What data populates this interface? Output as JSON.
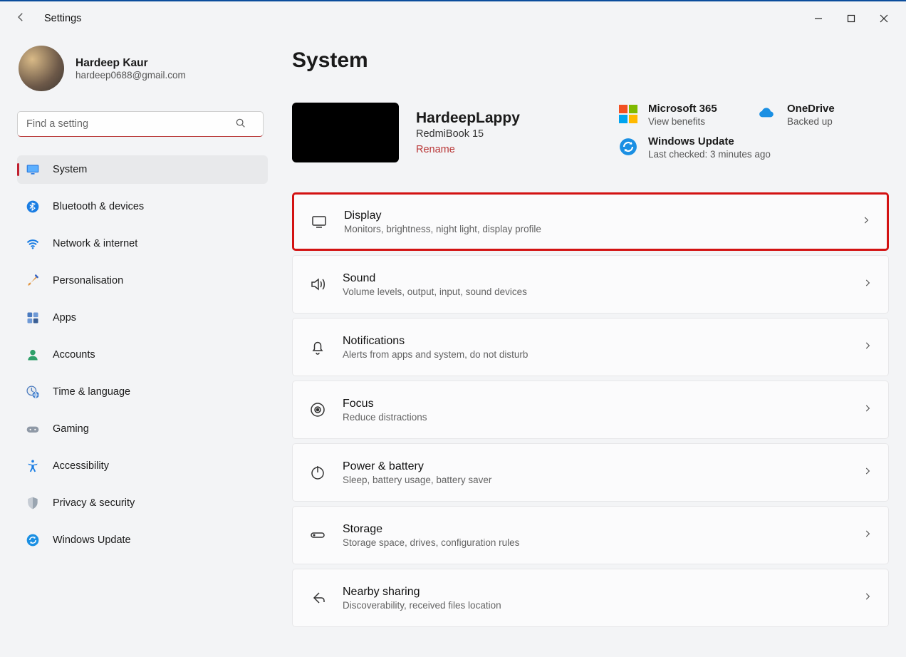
{
  "window": {
    "title": "Settings"
  },
  "profile": {
    "name": "Hardeep Kaur",
    "email": "hardeep0688@gmail.com"
  },
  "search": {
    "placeholder": "Find a setting"
  },
  "sidebar": {
    "items": [
      {
        "label": "System"
      },
      {
        "label": "Bluetooth & devices"
      },
      {
        "label": "Network & internet"
      },
      {
        "label": "Personalisation"
      },
      {
        "label": "Apps"
      },
      {
        "label": "Accounts"
      },
      {
        "label": "Time & language"
      },
      {
        "label": "Gaming"
      },
      {
        "label": "Accessibility"
      },
      {
        "label": "Privacy & security"
      },
      {
        "label": "Windows Update"
      }
    ]
  },
  "page": {
    "title": "System"
  },
  "device": {
    "name": "HardeepLappy",
    "model": "RedmiBook 15",
    "rename": "Rename"
  },
  "info": {
    "ms365": {
      "title": "Microsoft 365",
      "sub": "View benefits"
    },
    "onedrive": {
      "title": "OneDrive",
      "sub": "Backed up"
    },
    "update": {
      "title": "Windows Update",
      "sub": "Last checked: 3 minutes ago"
    }
  },
  "rows": [
    {
      "title": "Display",
      "sub": "Monitors, brightness, night light, display profile"
    },
    {
      "title": "Sound",
      "sub": "Volume levels, output, input, sound devices"
    },
    {
      "title": "Notifications",
      "sub": "Alerts from apps and system, do not disturb"
    },
    {
      "title": "Focus",
      "sub": "Reduce distractions"
    },
    {
      "title": "Power & battery",
      "sub": "Sleep, battery usage, battery saver"
    },
    {
      "title": "Storage",
      "sub": "Storage space, drives, configuration rules"
    },
    {
      "title": "Nearby sharing",
      "sub": "Discoverability, received files location"
    }
  ]
}
